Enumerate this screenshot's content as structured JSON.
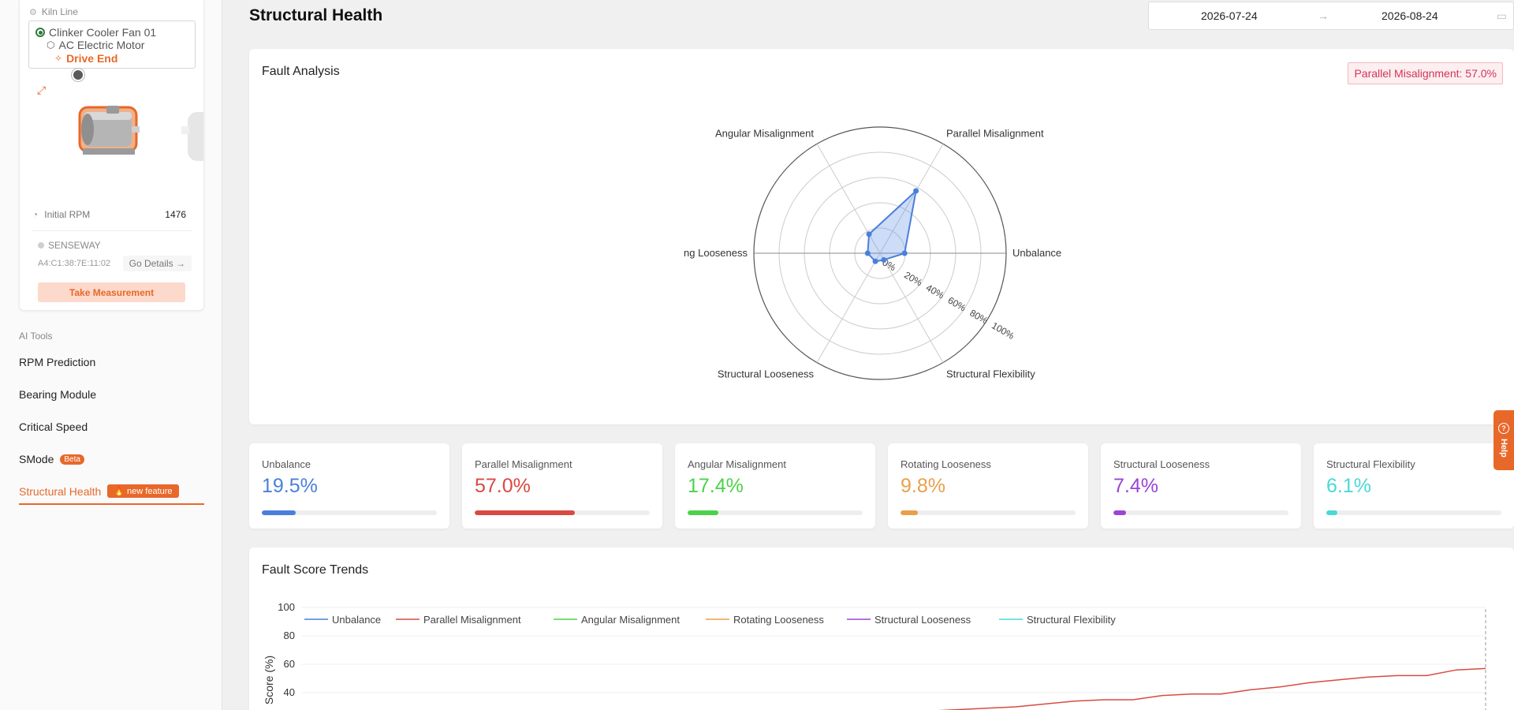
{
  "sidebar": {
    "kiln_line": "Kiln Line",
    "tree": {
      "equipment": "Clinker Cooler Fan 01",
      "component": "AC Electric Motor",
      "point": "Drive End"
    },
    "rpm_label": "Initial RPM",
    "rpm_value": "1476",
    "sensor_name": "SENSEWAY",
    "sensor_mac": "A4:C1:38:7E:11:02",
    "go_details": "Go Details",
    "take_measurement": "Take Measurement",
    "ai_tools_label": "AI Tools",
    "nav": {
      "rpm_prediction": "RPM Prediction",
      "bearing_module": "Bearing Module",
      "critical_speed": "Critical Speed",
      "smode": "SMode",
      "smode_badge": "Beta",
      "structural_health": "Structural Health",
      "structural_health_badge": "new feature"
    }
  },
  "header": {
    "title": "Structural Health",
    "date_start": "2026-07-24",
    "date_end": "2026-08-24"
  },
  "fault_analysis": {
    "title": "Fault Analysis",
    "badge": "Parallel Misalignment: 57.0%"
  },
  "radar_data": {
    "type": "radar",
    "axes": [
      "Unbalance",
      "Parallel Misalignment",
      "Angular Misalignment",
      "ng Looseness",
      "Structural Looseness",
      "Structural Flexibility"
    ],
    "values": [
      19.5,
      57.0,
      17.4,
      9.8,
      7.4,
      6.1
    ],
    "rlim": [
      0,
      100
    ],
    "ticks": [
      "0%",
      "20%",
      "40%",
      "60%",
      "80%",
      "100%"
    ]
  },
  "metrics": [
    {
      "name": "Unbalance",
      "value": "19.5%",
      "fraction": 0.195,
      "color": "#4a7fdc"
    },
    {
      "name": "Parallel Misalignment",
      "value": "57.0%",
      "fraction": 0.57,
      "color": "#d94a42"
    },
    {
      "name": "Angular Misalignment",
      "value": "17.4%",
      "fraction": 0.174,
      "color": "#4cd24a"
    },
    {
      "name": "Rotating Looseness",
      "value": "9.8%",
      "fraction": 0.098,
      "color": "#e8a04a"
    },
    {
      "name": "Structural Looseness",
      "value": "7.4%",
      "fraction": 0.074,
      "color": "#9a44d8"
    },
    {
      "name": "Structural Flexibility",
      "value": "6.1%",
      "fraction": 0.061,
      "color": "#4ad8d8"
    }
  ],
  "trends": {
    "title": "Fault Score Trends",
    "ylabel": "Score (%)"
  },
  "chart_data": {
    "type": "line",
    "ylim": [
      0,
      100
    ],
    "yticks": [
      "100",
      "80",
      "60",
      "40"
    ],
    "legend_position": "top-left",
    "series": [
      {
        "name": "Unbalance",
        "color": "#4a7fdc",
        "values": []
      },
      {
        "name": "Parallel Misalignment",
        "color": "#d94a42",
        "values": [
          27,
          28,
          29,
          30,
          32,
          34,
          35,
          35,
          38,
          39,
          39,
          42,
          44,
          47,
          49,
          51,
          52,
          52,
          56,
          57
        ]
      },
      {
        "name": "Angular Misalignment",
        "color": "#4cd24a",
        "values": []
      },
      {
        "name": "Rotating Looseness",
        "color": "#e8a04a",
        "values": []
      },
      {
        "name": "Structural Looseness",
        "color": "#9a44d8",
        "values": []
      },
      {
        "name": "Structural Flexibility",
        "color": "#4ad8d8",
        "values": []
      }
    ]
  },
  "help": {
    "label": "Help"
  }
}
